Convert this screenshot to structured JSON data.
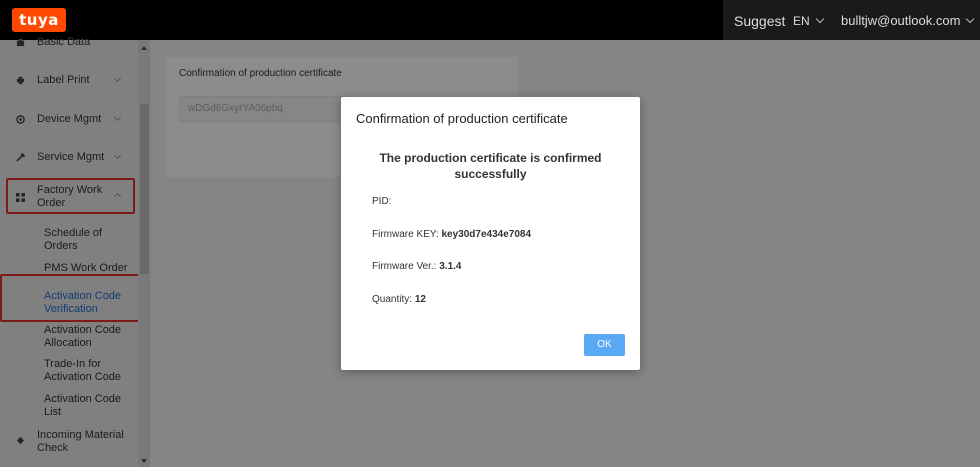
{
  "header": {
    "logo": "tuya",
    "suggest": "Suggest",
    "language": "EN",
    "user": "bulltjw@outlook.com"
  },
  "sidebar": {
    "items": [
      {
        "label": "Basic Data",
        "icon": "building-icon"
      },
      {
        "label": "Label Print",
        "icon": "printer-icon"
      },
      {
        "label": "Device Mgmt",
        "icon": "device-icon"
      },
      {
        "label": "Service Mgmt",
        "icon": "wrench-icon"
      },
      {
        "label": "Factory Work Order",
        "icon": "grid-icon"
      }
    ],
    "subitems": [
      {
        "label": "Schedule of Orders"
      },
      {
        "label": "PMS Work Order"
      },
      {
        "label": "Activation Code Verification"
      },
      {
        "label": "Activation Code Allocation"
      },
      {
        "label": "Trade-In for Activation Code"
      },
      {
        "label": "Activation Code List"
      }
    ],
    "bottom_item": {
      "label": "Incoming Material Check",
      "icon": "diamond-icon"
    }
  },
  "main": {
    "card_title": "Confirmation of production certificate",
    "input_value": "wDGd6GxyrYA06pbq"
  },
  "modal": {
    "title": "Confirmation of production certificate",
    "message": "The production certificate is confirmed successfully",
    "pid_label": "PID:",
    "pid_value": "",
    "fw_key_label": "Firmware KEY:",
    "fw_key_value": "key30d7e434e7084",
    "fw_ver_label": "Firmware Ver.:",
    "fw_ver_value": "3.1.4",
    "qty_label": "Quantity:",
    "qty_value": "12",
    "ok_label": "OK"
  },
  "colors": {
    "brand": "#ff4800",
    "active_link": "#1e6fcf",
    "highlight": "#e0332f",
    "button": "#5aa9f5"
  }
}
